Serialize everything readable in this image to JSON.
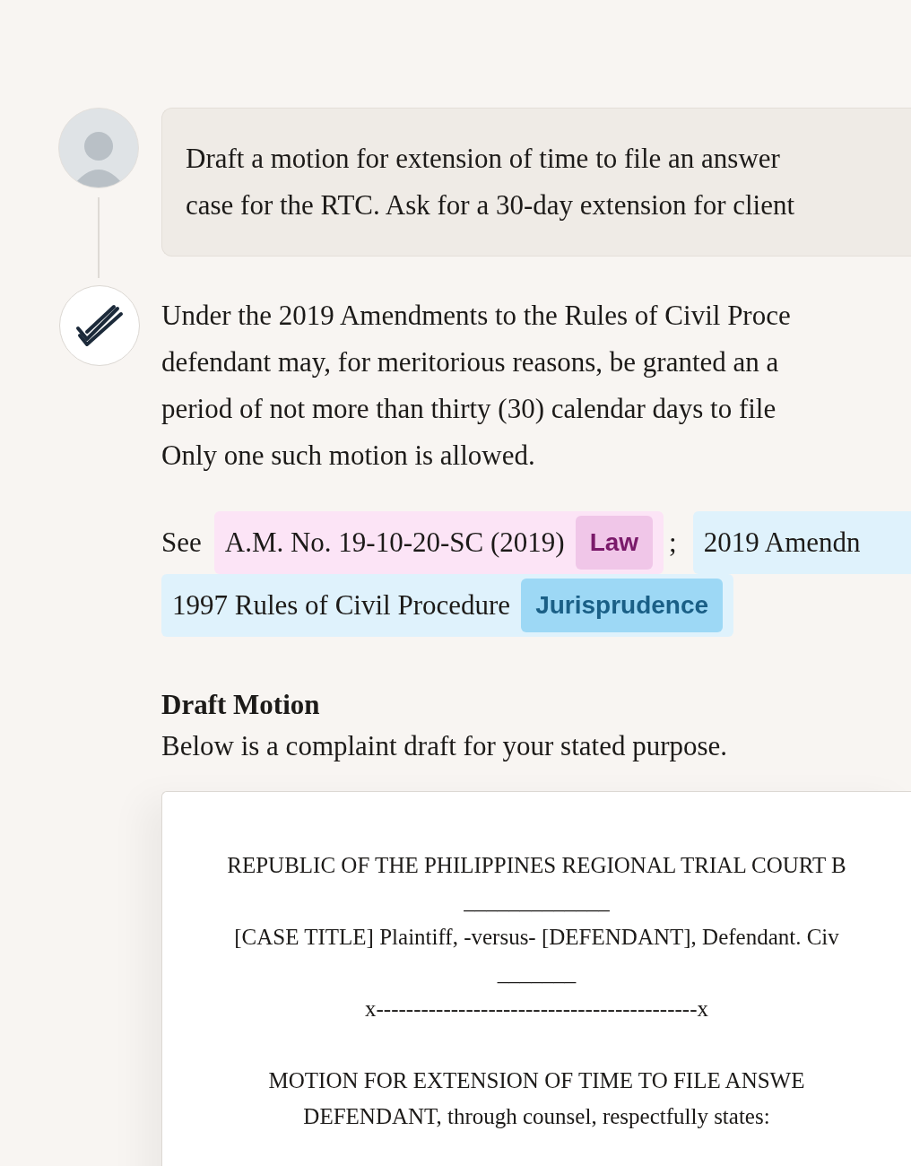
{
  "user_message": {
    "lines": [
      "Draft a motion for extension of time to file an answer",
      "case for the RTC.  Ask for a 30-day extension for client"
    ]
  },
  "answer": {
    "lines": [
      "Under the 2019 Amendments to the Rules of Civil Proce",
      "defendant may, for meritorious reasons, be granted an a",
      "period of not more than thirty (30) calendar days to file",
      "Only one such motion is allowed."
    ],
    "citations": {
      "lead": "See",
      "separator": ";",
      "items": [
        {
          "kind": "law",
          "lines": [
            "A.M. No. 19-10-20-SC (2019)"
          ],
          "tag": "Law"
        },
        {
          "kind": "jurisprudence",
          "lines": [
            "2019 Amendn",
            "1997 Rules of Civil Procedure"
          ],
          "tag": "Jurisprudence"
        }
      ]
    },
    "heading": "Draft Motion",
    "intro": "Below is a complaint draft for your stated purpose.",
    "document": {
      "lines": [
        {
          "kind": "line",
          "text": "REPUBLIC OF THE PHILIPPINES REGIONAL TRIAL COURT B"
        },
        {
          "kind": "rule",
          "text": "_____________"
        },
        {
          "kind": "line",
          "text": "[CASE TITLE] Plaintiff, -versus- [DEFENDANT], Defendant. Civ"
        },
        {
          "kind": "rule",
          "text": "_______"
        },
        {
          "kind": "line",
          "text": "x-------------------------------------------x"
        },
        {
          "kind": "heading",
          "text": "MOTION FOR EXTENSION OF TIME TO FILE ANSWE"
        },
        {
          "kind": "line",
          "text": "DEFENDANT, through counsel, respectfully states:"
        }
      ]
    }
  }
}
